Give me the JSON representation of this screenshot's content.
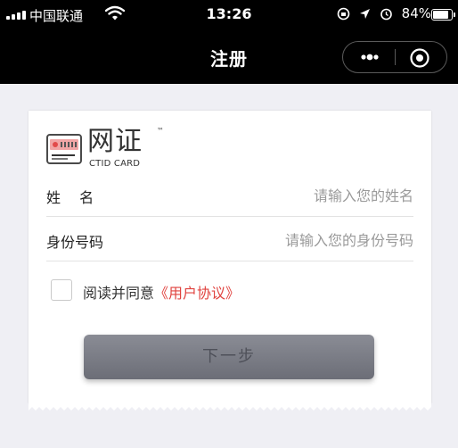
{
  "status_bar": {
    "carrier": "中国联通",
    "time": "13:26",
    "battery": "84%"
  },
  "nav": {
    "title": "注册",
    "menu_icon": "more-dots-icon",
    "close_icon": "record-circle-icon"
  },
  "brand": {
    "name_cn": "网证",
    "trademark": "™",
    "name_en": "CTID CARD",
    "icon": "id-card-icon"
  },
  "form": {
    "name_label": "姓　 名",
    "name_placeholder": "请输入您的姓名",
    "id_label": "身份号码",
    "id_placeholder": "请输入您的身份号码"
  },
  "agreement": {
    "prefix": "阅读并同意",
    "link": "《用户协议》",
    "checked": false
  },
  "actions": {
    "next_label": "下一步"
  },
  "colors": {
    "nav_bg": "#000000",
    "page_bg": "#efeff4",
    "link": "#e0433f",
    "button_bg": "#7a7c85"
  }
}
